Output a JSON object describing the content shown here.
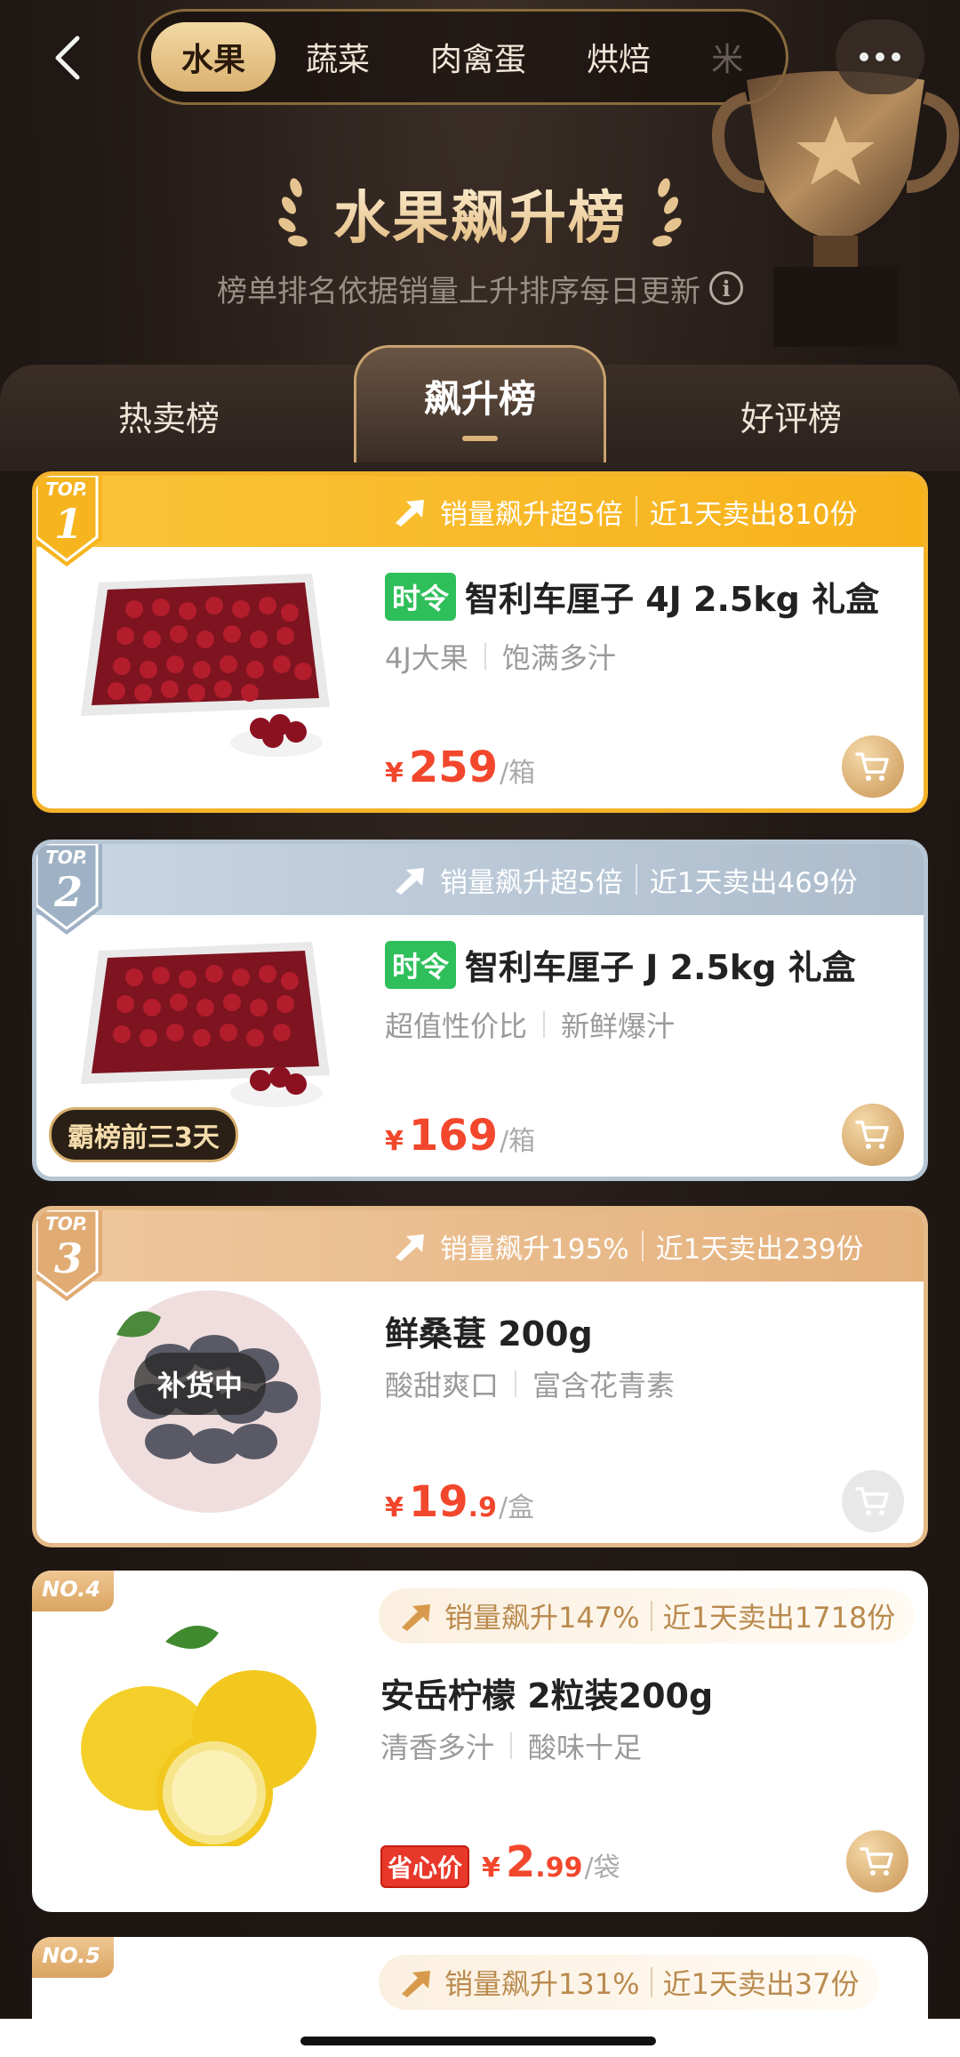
{
  "header": {
    "categories": [
      {
        "label": "水果",
        "active": true
      },
      {
        "label": "蔬菜"
      },
      {
        "label": "肉禽蛋"
      },
      {
        "label": "烘焙"
      },
      {
        "label": "米"
      }
    ],
    "title": "水果飙升榜",
    "subtitle": "榜单排名依据销量上升排序每日更新",
    "info_icon": "i"
  },
  "tabs": {
    "hot": "热卖榜",
    "rise": "飙升榜",
    "good": "好评榜"
  },
  "products": [
    {
      "rank_top": "TOP.",
      "rank_num": "1",
      "sales_rise": "销量飙升超5倍",
      "sales_day": "近1天卖出810份",
      "tag": "时令",
      "title": "智利车厘子 4J 2.5kg 礼盒",
      "attr1": "4J大果",
      "attr2": "饱满多汁",
      "currency": "¥",
      "price": "259",
      "unit": "/箱"
    },
    {
      "rank_top": "TOP.",
      "rank_num": "2",
      "sales_rise": "销量飙升超5倍",
      "sales_day": "近1天卖出469份",
      "tag": "时令",
      "title": "智利车厘子 J 2.5kg 礼盒",
      "attr1": "超值性价比",
      "attr2": "新鲜爆汁",
      "currency": "¥",
      "price": "169",
      "unit": "/箱",
      "badge": "霸榜前三3天"
    },
    {
      "rank_top": "TOP.",
      "rank_num": "3",
      "sales_rise": "销量飙升195%",
      "sales_day": "近1天卖出239份",
      "title": "鲜桑葚 200g",
      "attr1": "酸甜爽口",
      "attr2": "富含花青素",
      "currency": "¥",
      "price": "19",
      "price_dec": ".9",
      "unit": "/盒",
      "status": "补货中"
    },
    {
      "rank_label": "NO.4",
      "sales_rise": "销量飙升147%",
      "sales_day": "近1天卖出1718份",
      "title": "安岳柠檬 2粒装200g",
      "attr1": "清香多汁",
      "attr2": "酸味十足",
      "save_tag": "省心价",
      "currency": "¥",
      "price": "2",
      "price_dec": ".99",
      "unit": "/袋"
    },
    {
      "rank_label": "NO.5",
      "sales_rise": "销量飙升131%",
      "sales_day": "近1天卖出37份"
    }
  ]
}
